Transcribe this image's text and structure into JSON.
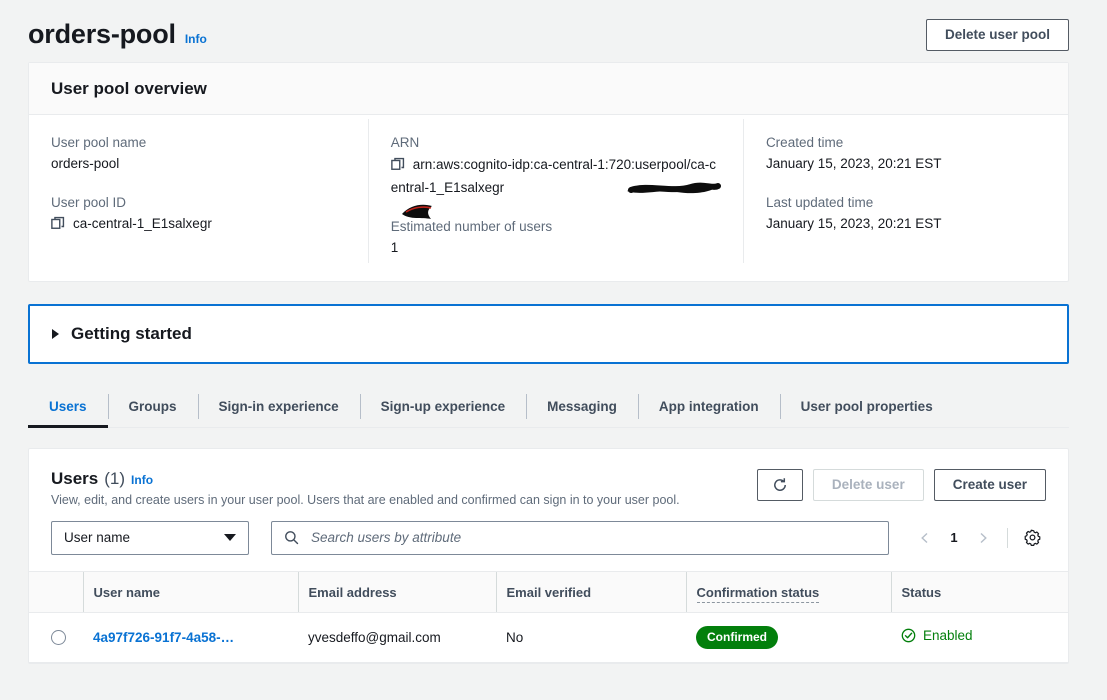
{
  "header": {
    "title": "orders-pool",
    "info_label": "Info",
    "delete_pool_button": "Delete user pool"
  },
  "overview": {
    "heading": "User pool overview",
    "fields": {
      "user_pool_name_label": "User pool name",
      "user_pool_name_value": "orders-pool",
      "user_pool_id_label": "User pool ID",
      "user_pool_id_value": "ca-central-1_E1salxegr",
      "arn_label": "ARN",
      "arn_value_line1": "arn:aws:cognito-idp:ca-central-1:",
      "arn_value_line2": "0:userpool/ca-central-1_E1salxegr",
      "arn_line2_prefix": "72",
      "estimated_users_label": "Estimated number of users",
      "estimated_users_value": "1",
      "created_time_label": "Created time",
      "created_time_value": "January 15, 2023, 20:21 EST",
      "last_updated_label": "Last updated time",
      "last_updated_value": "January 15, 2023, 20:21 EST"
    }
  },
  "getting_started": {
    "title": "Getting started",
    "expanded": false
  },
  "tabs": [
    {
      "label": "Users",
      "active": true
    },
    {
      "label": "Groups",
      "active": false
    },
    {
      "label": "Sign-in experience",
      "active": false
    },
    {
      "label": "Sign-up experience",
      "active": false
    },
    {
      "label": "Messaging",
      "active": false
    },
    {
      "label": "App integration",
      "active": false
    },
    {
      "label": "User pool properties",
      "active": false
    }
  ],
  "users_panel": {
    "title": "Users",
    "count": "(1)",
    "info_label": "Info",
    "description": "View, edit, and create users in your user pool. Users that are enabled and confirmed can sign in to your user pool.",
    "refresh_icon": "refresh-icon",
    "delete_user_button": "Delete user",
    "delete_user_disabled": true,
    "create_user_button": "Create user",
    "filter_select_value": "User name",
    "search_placeholder": "Search users by attribute",
    "search_value": "",
    "pagination": {
      "previous_icon": "chevron-left-icon",
      "page": "1",
      "next_icon": "chevron-right-icon",
      "settings_icon": "gear-icon"
    },
    "table": {
      "columns": [
        "User name",
        "Email address",
        "Email verified",
        "Confirmation status",
        "Status"
      ],
      "rows": [
        {
          "user_name": "4a97f726-91f7-4a58-…",
          "email_address": "yvesdeffo@gmail.com",
          "email_verified": "No",
          "confirmation_status": "Confirmed",
          "status": "Enabled"
        }
      ]
    }
  },
  "colors": {
    "accent_blue": "#0972d3",
    "status_green": "#037f0c",
    "text_dark": "#16191f",
    "text_muted": "#5f6b7a",
    "page_background": "#f2f3f3"
  }
}
